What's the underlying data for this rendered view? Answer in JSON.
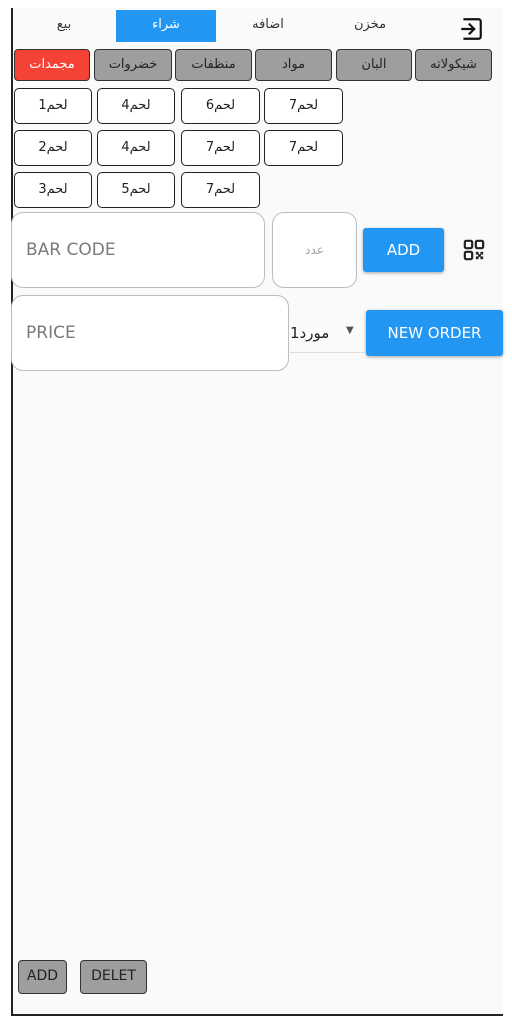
{
  "tabs": [
    {
      "label": "بيع"
    },
    {
      "label": "شراء",
      "active": true
    },
    {
      "label": "اضافه"
    },
    {
      "label": "مخزن"
    }
  ],
  "categories": [
    {
      "label": "مجمدات",
      "color": "#f44336"
    },
    {
      "label": "خضروات"
    },
    {
      "label": "منظفات"
    },
    {
      "label": "مواد"
    },
    {
      "label": "البان"
    },
    {
      "label": "شيكولاته"
    }
  ],
  "items": [
    [
      "لحم1",
      "لحم4",
      "لحم6",
      "لحم7"
    ],
    [
      "لحم2",
      "لحم4",
      "لحم7",
      "لحم7"
    ],
    [
      "لحم3",
      "لحم5",
      "لحم7"
    ]
  ],
  "barcode": {
    "placeholder": "BAR CODE"
  },
  "quantity": {
    "placeholder": "عدد"
  },
  "add_button": "ADD",
  "price": {
    "placeholder": "PRICE"
  },
  "supplier": {
    "selected": "مورد1"
  },
  "new_order_button": "NEW ORDER",
  "bottom": {
    "add": "ADD",
    "delete": "DELET"
  },
  "colors": {
    "accent": "#2196f3",
    "chip": "#9e9e9e",
    "highlight": "#f44336"
  },
  "icons": {
    "exit": "exit-to-app-icon",
    "qr": "qr-code-scanner-icon",
    "dropdown": "arrow-drop-down-icon"
  }
}
